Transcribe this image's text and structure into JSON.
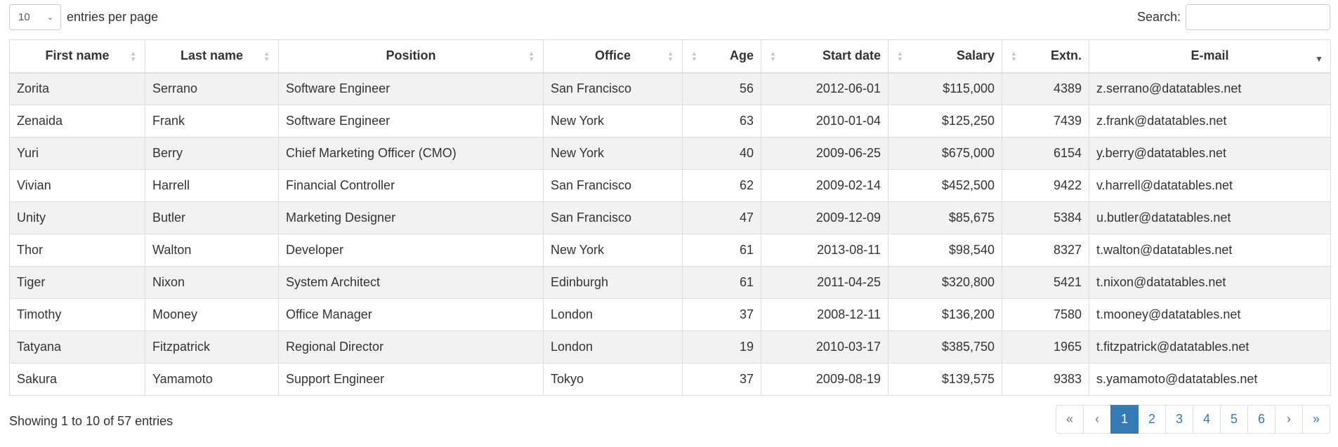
{
  "length": {
    "value": "10",
    "label": "entries per page"
  },
  "search": {
    "label": "Search:",
    "value": "",
    "placeholder": ""
  },
  "table": {
    "columns": [
      {
        "label": "First name"
      },
      {
        "label": "Last name"
      },
      {
        "label": "Position"
      },
      {
        "label": "Office"
      },
      {
        "label": "Age"
      },
      {
        "label": "Start date"
      },
      {
        "label": "Salary"
      },
      {
        "label": "Extn."
      },
      {
        "label": "E-mail"
      }
    ],
    "rows": [
      [
        "Zorita",
        "Serrano",
        "Software Engineer",
        "San Francisco",
        "56",
        "2012-06-01",
        "$115,000",
        "4389",
        "z.serrano@datatables.net"
      ],
      [
        "Zenaida",
        "Frank",
        "Software Engineer",
        "New York",
        "63",
        "2010-01-04",
        "$125,250",
        "7439",
        "z.frank@datatables.net"
      ],
      [
        "Yuri",
        "Berry",
        "Chief Marketing Officer (CMO)",
        "New York",
        "40",
        "2009-06-25",
        "$675,000",
        "6154",
        "y.berry@datatables.net"
      ],
      [
        "Vivian",
        "Harrell",
        "Financial Controller",
        "San Francisco",
        "62",
        "2009-02-14",
        "$452,500",
        "9422",
        "v.harrell@datatables.net"
      ],
      [
        "Unity",
        "Butler",
        "Marketing Designer",
        "San Francisco",
        "47",
        "2009-12-09",
        "$85,675",
        "5384",
        "u.butler@datatables.net"
      ],
      [
        "Thor",
        "Walton",
        "Developer",
        "New York",
        "61",
        "2013-08-11",
        "$98,540",
        "8327",
        "t.walton@datatables.net"
      ],
      [
        "Tiger",
        "Nixon",
        "System Architect",
        "Edinburgh",
        "61",
        "2011-04-25",
        "$320,800",
        "5421",
        "t.nixon@datatables.net"
      ],
      [
        "Timothy",
        "Mooney",
        "Office Manager",
        "London",
        "37",
        "2008-12-11",
        "$136,200",
        "7580",
        "t.mooney@datatables.net"
      ],
      [
        "Tatyana",
        "Fitzpatrick",
        "Regional Director",
        "London",
        "19",
        "2010-03-17",
        "$385,750",
        "1965",
        "t.fitzpatrick@datatables.net"
      ],
      [
        "Sakura",
        "Yamamoto",
        "Support Engineer",
        "Tokyo",
        "37",
        "2009-08-19",
        "$139,575",
        "9383",
        "s.yamamoto@datatables.net"
      ]
    ]
  },
  "info": "Showing 1 to 10 of 57 entries",
  "pagination": {
    "first": "«",
    "prev": "‹",
    "pages": [
      "1",
      "2",
      "3",
      "4",
      "5",
      "6"
    ],
    "next": "›",
    "last": "»",
    "active": "1"
  },
  "colors": {
    "accent": "#337ab7",
    "stripe": "#f2f2f2",
    "border": "#dddddd"
  },
  "icons": {
    "sort": "sort-both-icon",
    "sorted": "sort-desc-icon",
    "dropdown": "chevron-down-icon"
  }
}
